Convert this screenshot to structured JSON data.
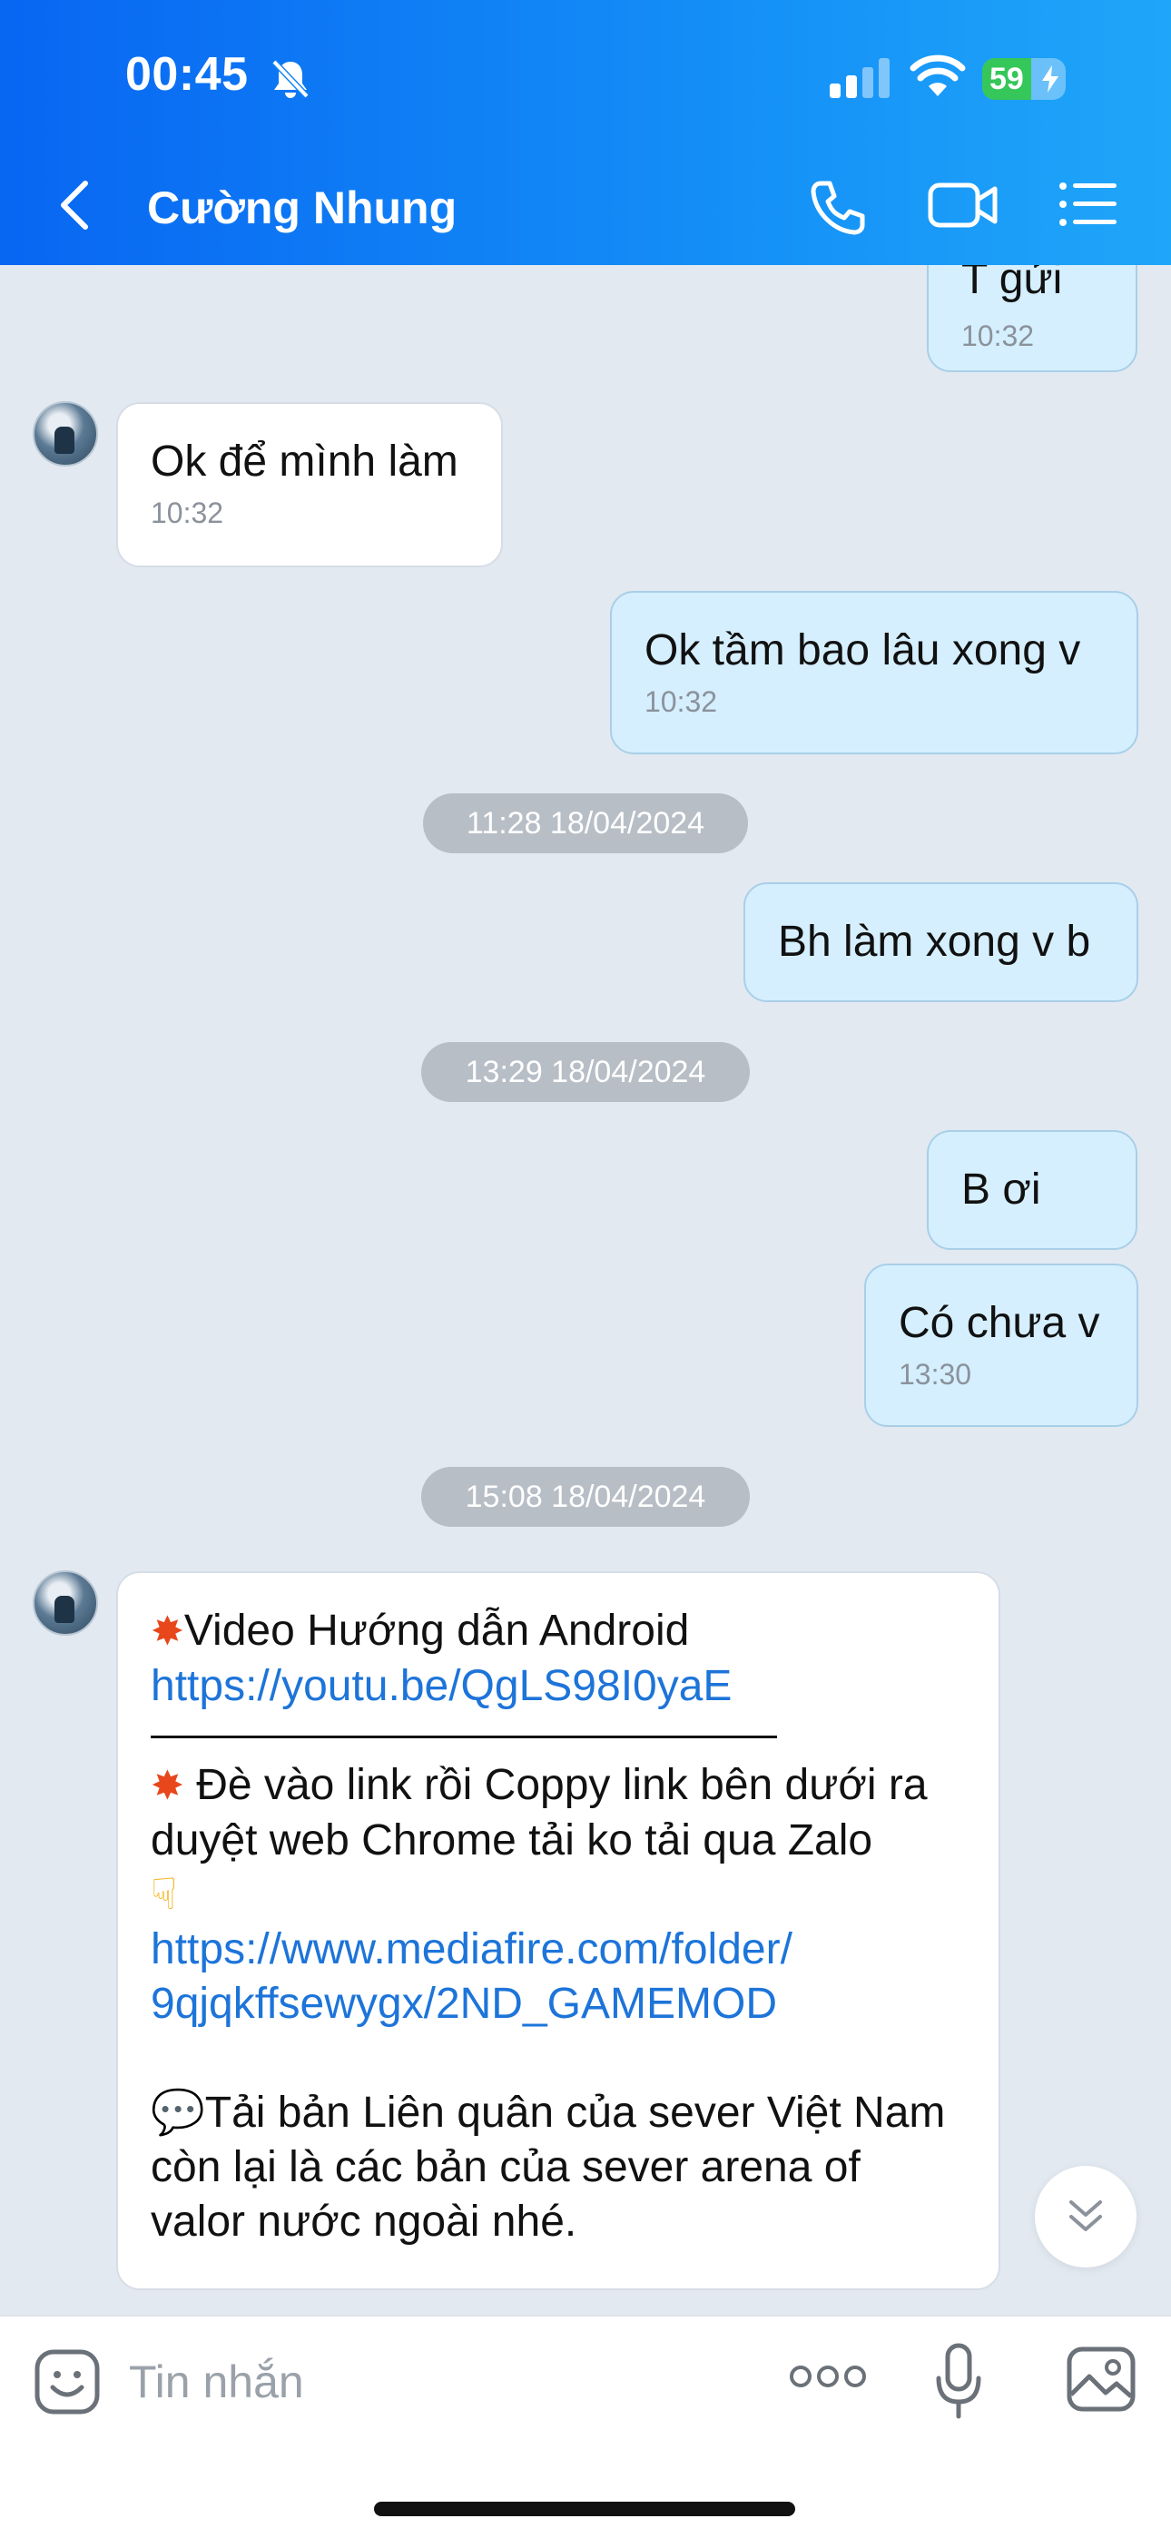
{
  "status_bar": {
    "time": "00:45",
    "battery": "59"
  },
  "header": {
    "contact_name": "Cường Nhung"
  },
  "messages": [
    {
      "dir": "out",
      "text": "T gửi",
      "time": "10:32"
    },
    {
      "dir": "in",
      "text": "Ok để mình làm",
      "time": "10:32"
    },
    {
      "dir": "out",
      "text": "Ok tầm bao lâu xong v",
      "time": "10:32"
    },
    {
      "dir": "out",
      "text": "Bh làm xong v b",
      "time": ""
    },
    {
      "dir": "out",
      "text": "B ơi",
      "time": ""
    },
    {
      "dir": "out",
      "text": "Có chưa v",
      "time": "13:30"
    }
  ],
  "date_separators": [
    "11:28 18/04/2024",
    "13:29 18/04/2024",
    "15:08 18/04/2024"
  ],
  "long_message": {
    "line1": "Video Hướng dẫn Android",
    "link1": "https://youtu.be/QgLS98I0yaE",
    "line2": "Đè vào link rồi Coppy link bên dưới ra duyệt web Chrome tải ko tải qua Zalo",
    "link2a": "https://www.mediafire.com/folder/",
    "link2b": "9qjqkffsewygx/2ND_GAMEMOD",
    "line3": "Tải bản Liên quân của sever Việt Nam còn lại là các bản của sever arena of valor nước ngoài nhé."
  },
  "composer": {
    "placeholder": "Tin nhắn"
  },
  "colors": {
    "header_start": "#0866f2",
    "header_end": "#1fa6f9",
    "outgoing_bubble": "#d5efff",
    "incoming_bubble": "#ffffff",
    "link": "#1d74d9",
    "chat_background": "#e2e9f1"
  },
  "icons": [
    "bell-slash-icon",
    "signal-icon",
    "wifi-icon",
    "battery-icon",
    "back-icon",
    "phone-icon",
    "video-call-icon",
    "menu-list-icon",
    "chevron-double-down-icon",
    "sticker-icon",
    "more-icon",
    "mic-icon",
    "image-icon"
  ]
}
